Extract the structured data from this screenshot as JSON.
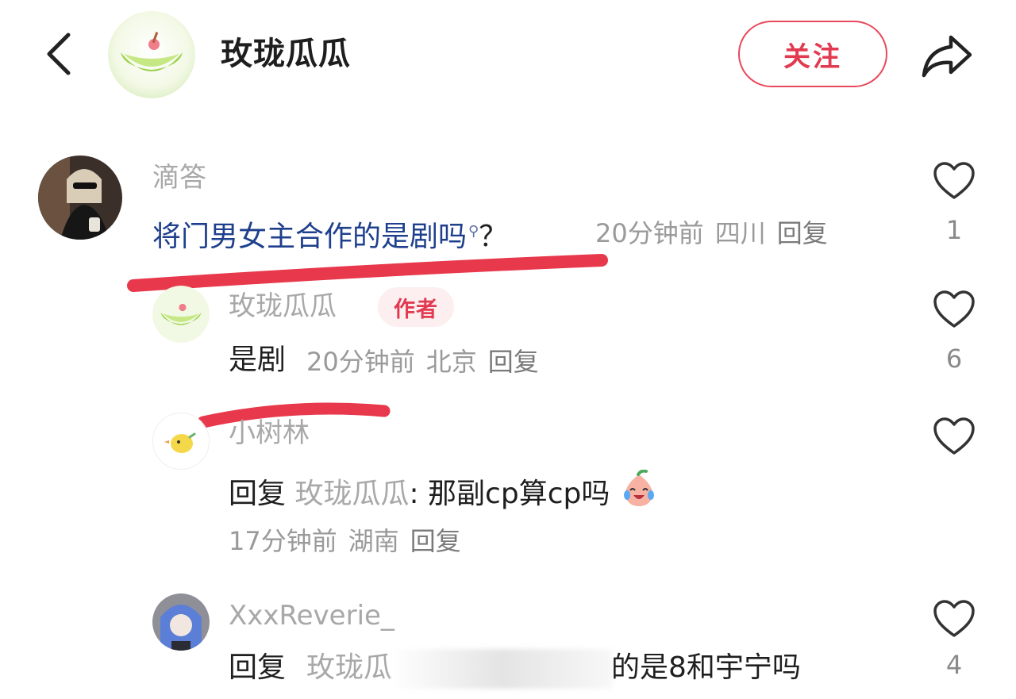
{
  "header": {
    "title": "玫珑瓜瓜",
    "follow_label": "关注",
    "back_icon": "chevron-left-icon",
    "share_icon": "share-arrow-icon"
  },
  "colors": {
    "accent": "#e23a50",
    "highlight_text": "#1e3f8c",
    "marker": "#e8384c",
    "muted": "#a8a8a8"
  },
  "comments": [
    {
      "user": "滴答",
      "text": "将门男女主合作的是剧吗",
      "suffix": "？",
      "time": "20分钟前",
      "location": "四川",
      "reply_label": "回复",
      "likes": "1"
    },
    {
      "user": "玫珑瓜瓜",
      "badge": "作者",
      "text": "是剧",
      "time": "20分钟前",
      "location": "北京",
      "reply_label": "回复",
      "likes": "6"
    },
    {
      "user": "小树林",
      "reply_prefix": "回复",
      "reply_to": "玫珑瓜瓜",
      "text": ": 那副cp算cp吗",
      "emoji": "crying-laughing-peach-emoji",
      "time": "17分钟前",
      "location": "湖南",
      "reply_label": "回复"
    },
    {
      "user": "XxxReverie_",
      "reply_prefix": "回复",
      "reply_to": "玫珑瓜",
      "text_tail": "的是8和宇宁吗",
      "likes": "4"
    }
  ]
}
